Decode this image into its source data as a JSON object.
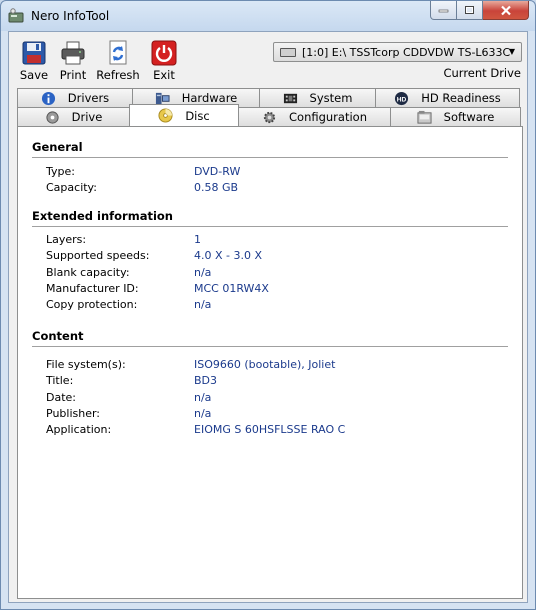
{
  "window": {
    "title": "Nero InfoTool"
  },
  "toolbar": {
    "save_label": "Save",
    "print_label": "Print",
    "refresh_label": "Refresh",
    "exit_label": "Exit"
  },
  "drive": {
    "selected": "[1:0]  E:\\ TSSTcorp CDDVDW TS-L633C",
    "caption": "Current Drive"
  },
  "tabs": {
    "top": [
      "Drivers",
      "Hardware",
      "System",
      "HD Readiness"
    ],
    "bottom": [
      "Drive",
      "Disc",
      "Configuration",
      "Software"
    ],
    "selected": "Disc"
  },
  "general": {
    "title": "General",
    "rows": [
      {
        "label": "Type:",
        "value": "DVD-RW"
      },
      {
        "label": "Capacity:",
        "value": "0.58 GB"
      }
    ]
  },
  "extended": {
    "title": "Extended information",
    "rows": [
      {
        "label": "Layers:",
        "value": "1"
      },
      {
        "label": "Supported speeds:",
        "value": "4.0 X - 3.0 X"
      },
      {
        "label": "Blank capacity:",
        "value": "n/a"
      },
      {
        "label": "Manufacturer ID:",
        "value": "MCC 01RW4X"
      },
      {
        "label": "Copy protection:",
        "value": "n/a"
      }
    ]
  },
  "content": {
    "title": "Content",
    "rows": [
      {
        "label": "File system(s):",
        "value": "ISO9660 (bootable), Joliet"
      },
      {
        "label": "Title:",
        "value": "BD3"
      },
      {
        "label": "Date:",
        "value": "n/a"
      },
      {
        "label": "Publisher:",
        "value": "n/a"
      },
      {
        "label": "Application:",
        "value": "EIOMG S 60HSFLSSE RAO C"
      }
    ]
  },
  "colors": {
    "value_text": "#1b3a8c",
    "exit_red": "#d42020"
  }
}
